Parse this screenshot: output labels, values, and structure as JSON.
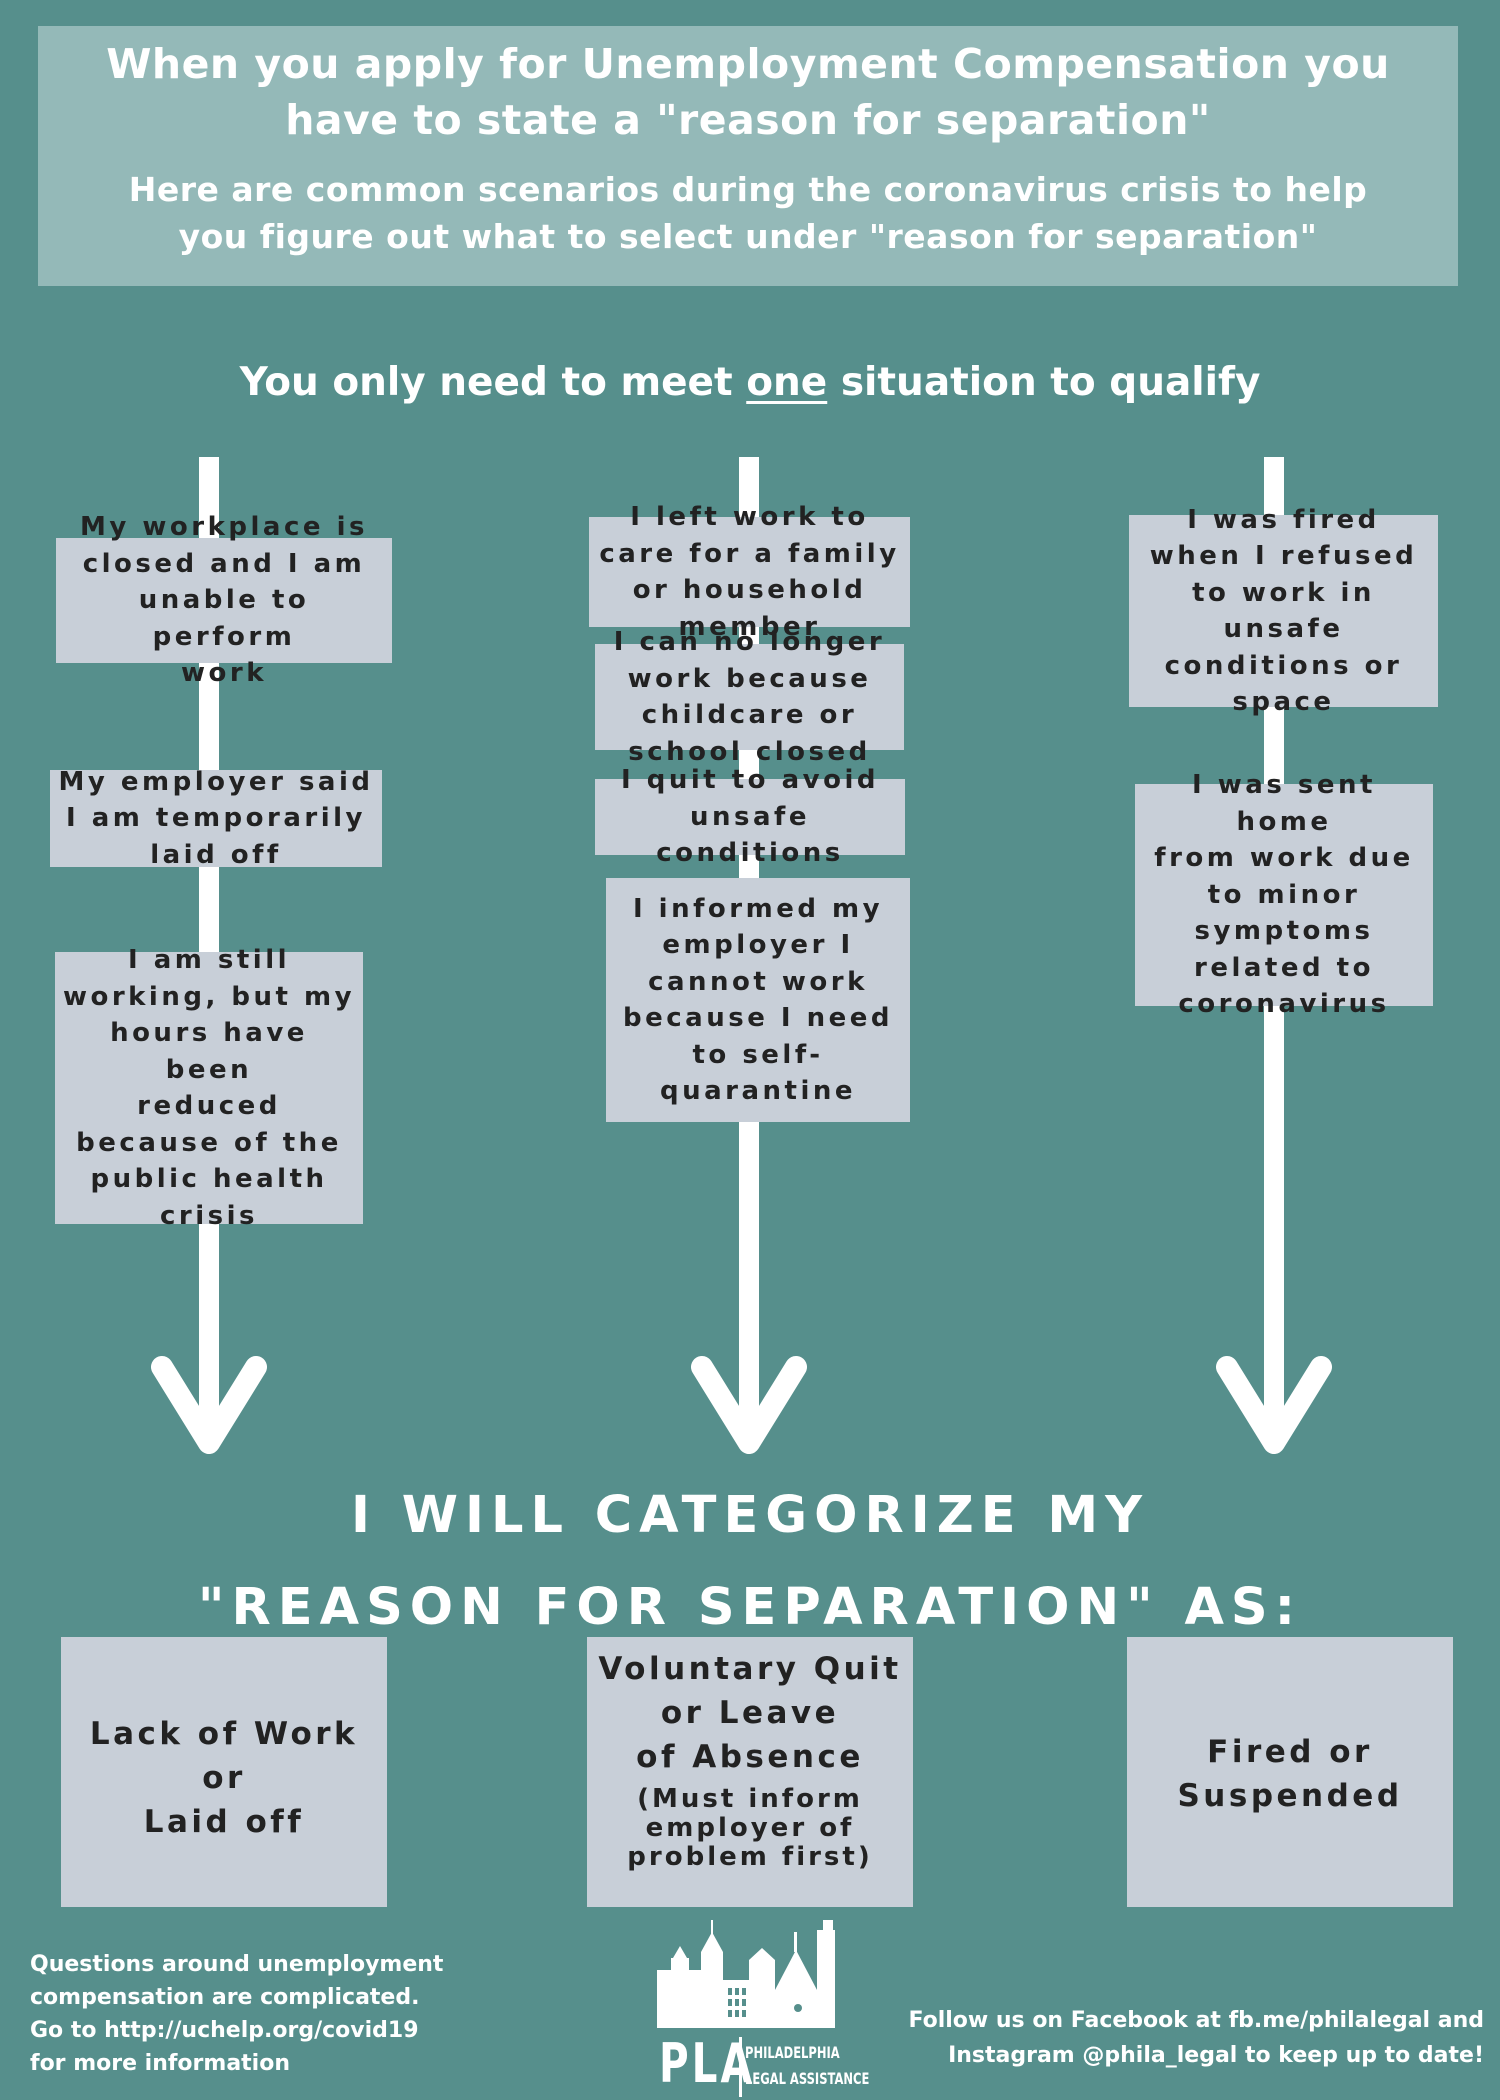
{
  "header": {
    "title_lines": [
      "When you apply for Unemployment Compensation you",
      "have to state a \"reason for separation\""
    ],
    "subtitle_lines": [
      "Here are common scenarios during the coronavirus crisis to help",
      "you figure out what to select under \"reason for separation\""
    ]
  },
  "qualify": {
    "before": "You only need to meet ",
    "emphasis": "one",
    "after": " situation to qualify"
  },
  "columns": [
    {
      "scenarios": [
        [
          "My workplace is",
          "closed and I am",
          "unable to perform",
          "work"
        ],
        [
          "My employer said",
          "I am temporarily",
          "laid off"
        ],
        [
          "I am still",
          "working, but my",
          "hours have been",
          "reduced",
          "because of the",
          "public health",
          "crisis"
        ]
      ]
    },
    {
      "scenarios": [
        [
          "I left work to",
          "care for a family",
          "or household",
          "member"
        ],
        [
          "I can no longer",
          "work because",
          "childcare or",
          "school closed"
        ],
        [
          "I quit to avoid",
          "unsafe",
          "conditions"
        ],
        [
          "I informed my",
          "employer I",
          "cannot work",
          "because I need",
          "to self-",
          "quarantine"
        ]
      ]
    },
    {
      "scenarios": [
        [
          "I was fired",
          "when I refused",
          "to work in",
          "unsafe",
          "conditions or",
          "space"
        ],
        [
          "I was sent",
          "home",
          "from work due",
          "to minor",
          "symptoms",
          "related to",
          "coronavirus"
        ]
      ]
    }
  ],
  "categorize": {
    "lines": [
      "I WILL CATEGORIZE MY",
      "\"REASON FOR SEPARATION\" AS:"
    ]
  },
  "categories": [
    {
      "main": [
        "Lack of Work",
        "or",
        "Laid off"
      ],
      "note": []
    },
    {
      "main": [
        "Voluntary Quit",
        "or Leave",
        "of Absence"
      ],
      "note": [
        "(Must inform",
        "employer of",
        "problem first)"
      ]
    },
    {
      "main": [
        "Fired or",
        "Suspended"
      ],
      "note": []
    }
  ],
  "footer": {
    "left_lines": [
      "Questions around unemployment",
      "compensation are complicated.",
      "Go to http://uchelp.org/covid19",
      "for more information"
    ],
    "right_lines": [
      "Follow us on Facebook at fb.me/philalegal and",
      "Instagram @phila_legal to keep up to date!"
    ],
    "logo": {
      "abbr": "PLA",
      "name_lines": [
        "PHILADELPHIA",
        "LEGAL ASSISTANCE"
      ]
    }
  },
  "colors": {
    "background": "#568f8c",
    "header_box": "#94b9b8",
    "card": "#c8cfd8",
    "text_dark": "#222222",
    "text_light": "#ffffff"
  }
}
